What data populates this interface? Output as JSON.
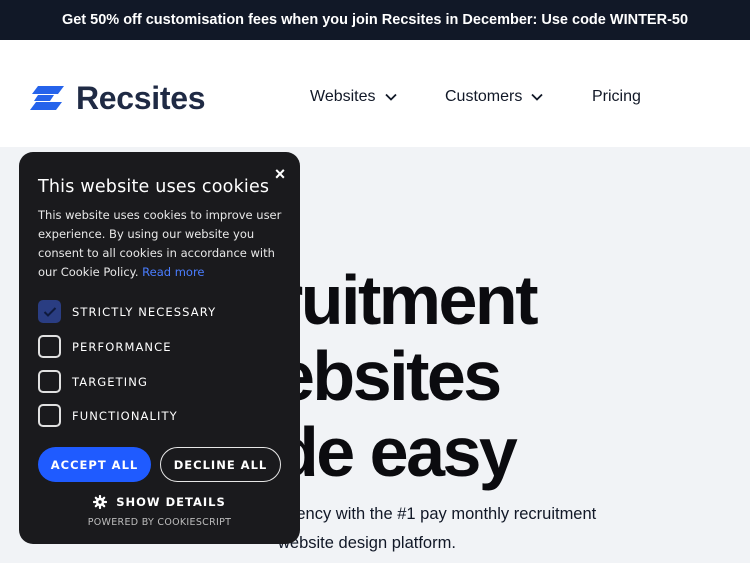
{
  "promo": {
    "text": "Get 50% off customisation fees when you join Recsites in December: Use code WINTER-50"
  },
  "brand": {
    "name": "Recsites",
    "accent": "#2563eb"
  },
  "nav": {
    "items": [
      {
        "label": "Websites",
        "icon": "chevron-down-icon"
      },
      {
        "label": "Customers",
        "icon": "chevron-down-icon"
      },
      {
        "label": "Pricing"
      }
    ]
  },
  "hero": {
    "title_lines": [
      "ruitment",
      "ebsites",
      "de easy"
    ],
    "subtitle_lines": [
      "agency with the #1 pay monthly recruitment",
      "website design platform."
    ]
  },
  "cookie_banner": {
    "title": "This website uses cookies",
    "close": "×",
    "body": "This website uses cookies to improve user experience. By using our website you consent to all cookies in accordance with our Cookie Policy.",
    "read_more": "Read more",
    "options": [
      {
        "label": "STRICTLY NECESSARY",
        "checked": true
      },
      {
        "label": "PERFORMANCE",
        "checked": false
      },
      {
        "label": "TARGETING",
        "checked": false
      },
      {
        "label": "FUNCTIONALITY",
        "checked": false
      }
    ],
    "accept_label": "ACCEPT ALL",
    "decline_label": "DECLINE ALL",
    "details_label": "SHOW DETAILS",
    "powered_by": "POWERED BY COOKIESCRIPT",
    "colors": {
      "background": "#1a1a1d",
      "accept": "#1f5bff",
      "link": "#4a7dff"
    }
  }
}
